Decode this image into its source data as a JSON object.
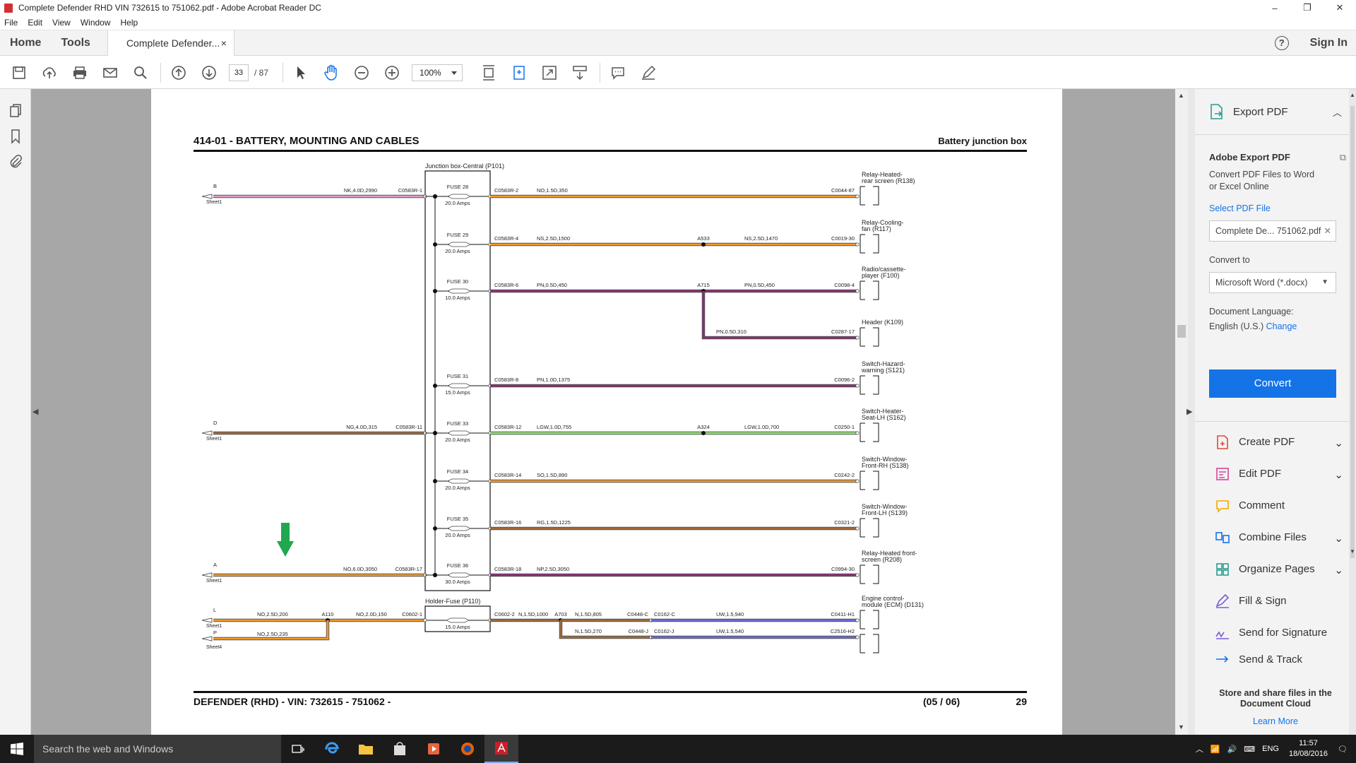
{
  "window": {
    "title": "Complete Defender RHD VIN 732615 to 751062.pdf - Adobe Acrobat Reader DC",
    "controls": [
      "–",
      "❐",
      "✕"
    ]
  },
  "menu": [
    "File",
    "Edit",
    "View",
    "Window",
    "Help"
  ],
  "tabs": {
    "home": "Home",
    "tools": "Tools",
    "document": "Complete Defender...",
    "close": "×",
    "help": "?",
    "sign_in": "Sign In"
  },
  "toolbar": {
    "page_current": "33",
    "page_total": "/ 87",
    "zoom": "100%"
  },
  "document": {
    "header_left": "414-01 - BATTERY, MOUNTING AND CABLES",
    "header_right": "Battery junction box",
    "footer_left": "DEFENDER (RHD) - VIN: 732615 - 751062 -",
    "footer_mid": "(05 / 06)",
    "footer_right": "29",
    "jb_title": "Junction box-Central (P101)",
    "holder_title": "Holder-Fuse (P110)",
    "sources": [
      {
        "letter": "B",
        "sheet": "Sheet1",
        "wire": "NK,4.0D,2990",
        "conn": "C0583R-1"
      },
      {
        "letter": "D",
        "sheet": "Sheet1",
        "wire": "NG,4.0D,315",
        "conn": "C0583R-11"
      },
      {
        "letter": "A",
        "sheet": "Sheet1",
        "wire": "NO,6.0D,3050",
        "conn": "C0583R-17"
      },
      {
        "letter": "L",
        "sheet": "Sheet1",
        "wire": "NO,2.5D,200"
      },
      {
        "letter": "P",
        "sheet": "Sheet4",
        "wire": "NO,2.5D,235"
      }
    ],
    "l_splice": {
      "node": "A110",
      "wire": "NO,2.0D,150",
      "conn": "C0602-1"
    },
    "fuses": [
      {
        "fuse": "FUSE 28",
        "amps": "20.0 Amps",
        "conn": "C0583R-2",
        "wire": "NO,1.5D,350",
        "end": "C0044-87",
        "dest": [
          "Relay-Heated-",
          "rear screen (R138)"
        ]
      },
      {
        "fuse": "FUSE 29",
        "amps": "20.0 Amps",
        "conn": "C0583R-4",
        "wire": "NS,2.5D,1500",
        "node": "A533",
        "wire2": "NS,2.5D,1470",
        "end": "C0019-30",
        "dest": [
          "Relay-Cooling-",
          "fan (R117)"
        ]
      },
      {
        "fuse": "FUSE 30",
        "amps": "10.0 Amps",
        "conn": "C0583R-6",
        "wire": "PN,0.5D,450",
        "node": "A715",
        "wire2": "PN,0.5D,450",
        "end": "C0098-4",
        "dest": [
          "Radio/cassette-",
          "player (F100)"
        ]
      },
      {
        "wire2": "PN,0.5D,310",
        "end": "C0287-17",
        "dest": [
          "Header (K109)"
        ]
      },
      {
        "fuse": "FUSE 31",
        "amps": "15.0 Amps",
        "conn": "C0583R-8",
        "wire": "PN,1.0D,1375",
        "end": "C0096-2",
        "dest": [
          "Switch-Hazard-",
          "warning (S121)"
        ]
      },
      {
        "fuse": "FUSE 33",
        "amps": "20.0 Amps",
        "conn": "C0583R-12",
        "wire": "LGW,1.0D,755",
        "node": "A324",
        "wire2": "LGW,1.0D,700",
        "end": "C0250-1",
        "dest": [
          "Switch-Heater-",
          "Seat-LH (S162)"
        ]
      },
      {
        "fuse": "FUSE 34",
        "amps": "20.0 Amps",
        "conn": "C0583R-14",
        "wire": "SO,1.5D,890",
        "end": "C0242-2",
        "dest": [
          "Switch-Window-",
          "Front-RH (S138)"
        ]
      },
      {
        "fuse": "FUSE 35",
        "amps": "20.0 Amps",
        "conn": "C0583R-16",
        "wire": "RG,1.5D,1225",
        "end": "C0321-2",
        "dest": [
          "Switch-Window-",
          "Front-LH (S139)"
        ]
      },
      {
        "fuse": "FUSE 36",
        "amps": "30.0 Amps",
        "conn": "C0583R-18",
        "wire": "NP,2.5D,3050",
        "end": "C0994-30",
        "dest": [
          "Relay-Heated front-",
          "screen (R208)"
        ]
      }
    ],
    "holder": {
      "amps": "15.0 Amps",
      "conn": "C0602-2",
      "wire": "N,1.5D,1000",
      "node": "A703",
      "wire_a": "N,1.5D,805",
      "conn_a1": "C0448-C",
      "conn_a2": "C0162-C",
      "wire_a2": "UW,1.5,940",
      "end_a": "C0411-H1",
      "wire_b": "N,1.5D,270",
      "conn_b1": "C0448-J",
      "conn_b2": "C0162-J",
      "wire_b2": "UW,1.5,540",
      "end_b": "C2516-H2",
      "dest": [
        "Engine control-",
        "module (ECM) (D131)"
      ]
    }
  },
  "right_panel": {
    "export_title": "Export PDF",
    "adobe_export": "Adobe Export PDF",
    "desc": [
      "Convert PDF Files to Word",
      "or Excel Online"
    ],
    "select_file": "Select PDF File",
    "file_name": "Complete De... 751062.pdf",
    "convert_to": "Convert to",
    "format": "Microsoft Word (*.docx)",
    "doc_lang": "Document Language:",
    "lang": "English (U.S.)",
    "change": "Change",
    "convert_btn": "Convert",
    "tools": [
      "Create PDF",
      "Edit PDF",
      "Comment",
      "Combine Files",
      "Organize Pages",
      "Fill & Sign",
      "Send for Signature",
      "Send & Track"
    ],
    "footer": [
      "Store and share files in the",
      "Document Cloud"
    ],
    "learn_more": "Learn More"
  },
  "taskbar": {
    "search": "Search the web and Windows",
    "lang": "ENG",
    "time": "11:57",
    "date": "18/08/2016"
  },
  "colors": {
    "accent": "#1473e6",
    "arrow": "#1fa84f",
    "wire_pink": "#e0a0c8",
    "wire_orange": "#f39c2b",
    "wire_brown": "#a06a3a",
    "wire_purple": "#8e2a7a",
    "wire_green": "#8ee86e",
    "wire_uw": "#6a6ad8"
  }
}
